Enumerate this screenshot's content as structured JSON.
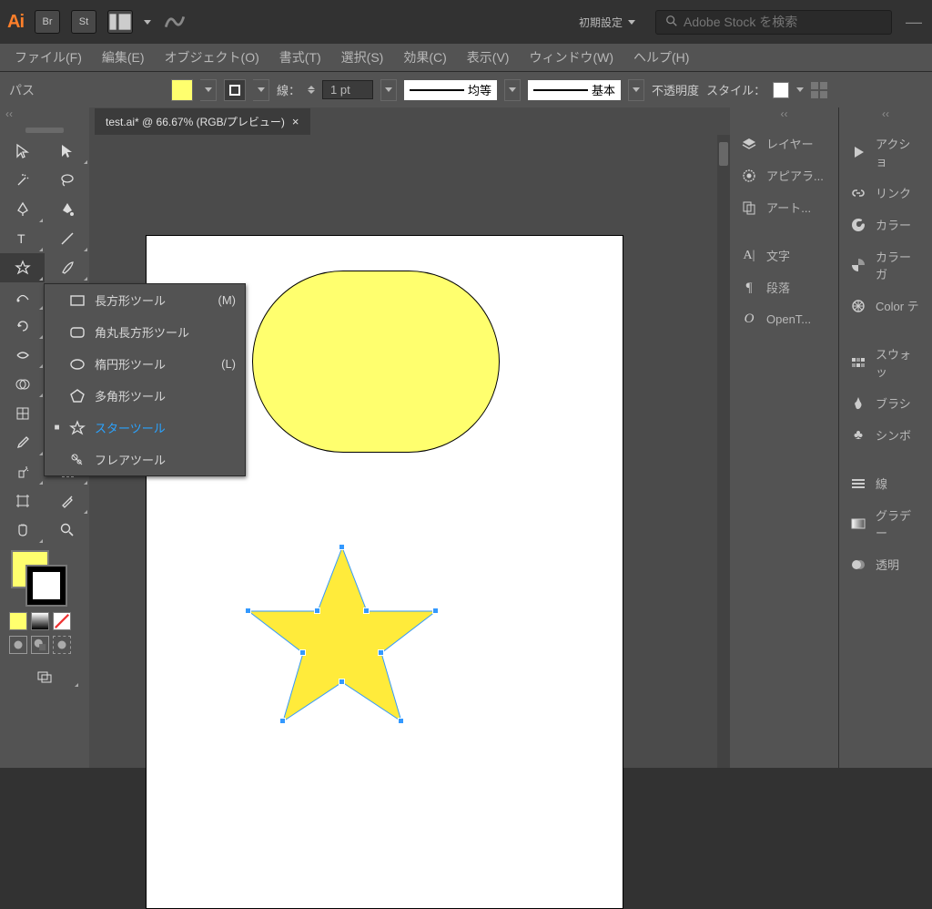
{
  "app_bar": {
    "logo": "Ai",
    "icons": [
      "Br",
      "St"
    ],
    "workspace_label": "初期設定",
    "search_placeholder": "Adobe Stock を検索"
  },
  "menu": {
    "items": [
      "ファイル(F)",
      "編集(E)",
      "オブジェクト(O)",
      "書式(T)",
      "選択(S)",
      "効果(C)",
      "表示(V)",
      "ウィンドウ(W)",
      "ヘルプ(H)"
    ]
  },
  "control": {
    "object_type": "パス",
    "stroke_label": "線：",
    "stroke_weight": "1 pt",
    "profile_uniform": "均等",
    "profile_basic": "基本",
    "opacity_label": "不透明度",
    "style_label": "スタイル：",
    "fill_color": "#ffff6e",
    "stroke_color": "#000000"
  },
  "document": {
    "tab_title": "test.ai* @ 66.67% (RGB/プレビュー)"
  },
  "tool_flyout": {
    "items": [
      {
        "label": "長方形ツール",
        "shortcut": "(M)"
      },
      {
        "label": "角丸長方形ツール",
        "shortcut": ""
      },
      {
        "label": "楕円形ツール",
        "shortcut": "(L)"
      },
      {
        "label": "多角形ツール",
        "shortcut": ""
      },
      {
        "label": "スターツール",
        "shortcut": ""
      },
      {
        "label": "フレアツール",
        "shortcut": ""
      }
    ],
    "selected_index": 4
  },
  "right_panels": {
    "col_a": [
      {
        "icon": "layers-icon",
        "label": "レイヤー"
      },
      {
        "icon": "appearance-icon",
        "label": "アピアラ..."
      },
      {
        "icon": "artboard-icon",
        "label": "アート..."
      },
      "gap",
      {
        "icon": "character-icon",
        "label": "文字"
      },
      {
        "icon": "paragraph-icon",
        "label": "段落"
      },
      {
        "icon": "opentype-icon",
        "label": "OpenT..."
      }
    ],
    "col_b": [
      {
        "icon": "play-icon",
        "label": "アクショ"
      },
      {
        "icon": "link-icon",
        "label": "リンク"
      },
      {
        "icon": "color-icon",
        "label": "カラー"
      },
      {
        "icon": "colorguide-icon",
        "label": "カラーガ"
      },
      {
        "icon": "colortheme-icon",
        "label": "Color テ"
      },
      "gap",
      {
        "icon": "swatches-icon",
        "label": "スウォッ"
      },
      {
        "icon": "brushes-icon",
        "label": "ブラシ"
      },
      {
        "icon": "symbols-icon",
        "label": "シンボ"
      },
      "gap",
      {
        "icon": "stroke-icon",
        "label": "線"
      },
      {
        "icon": "gradient-icon",
        "label": "グラデー"
      },
      {
        "icon": "transparency-icon",
        "label": "透明"
      }
    ]
  },
  "canvas": {
    "pill_fill": "#ffff6e",
    "star_fill": "#ffeb3b"
  }
}
